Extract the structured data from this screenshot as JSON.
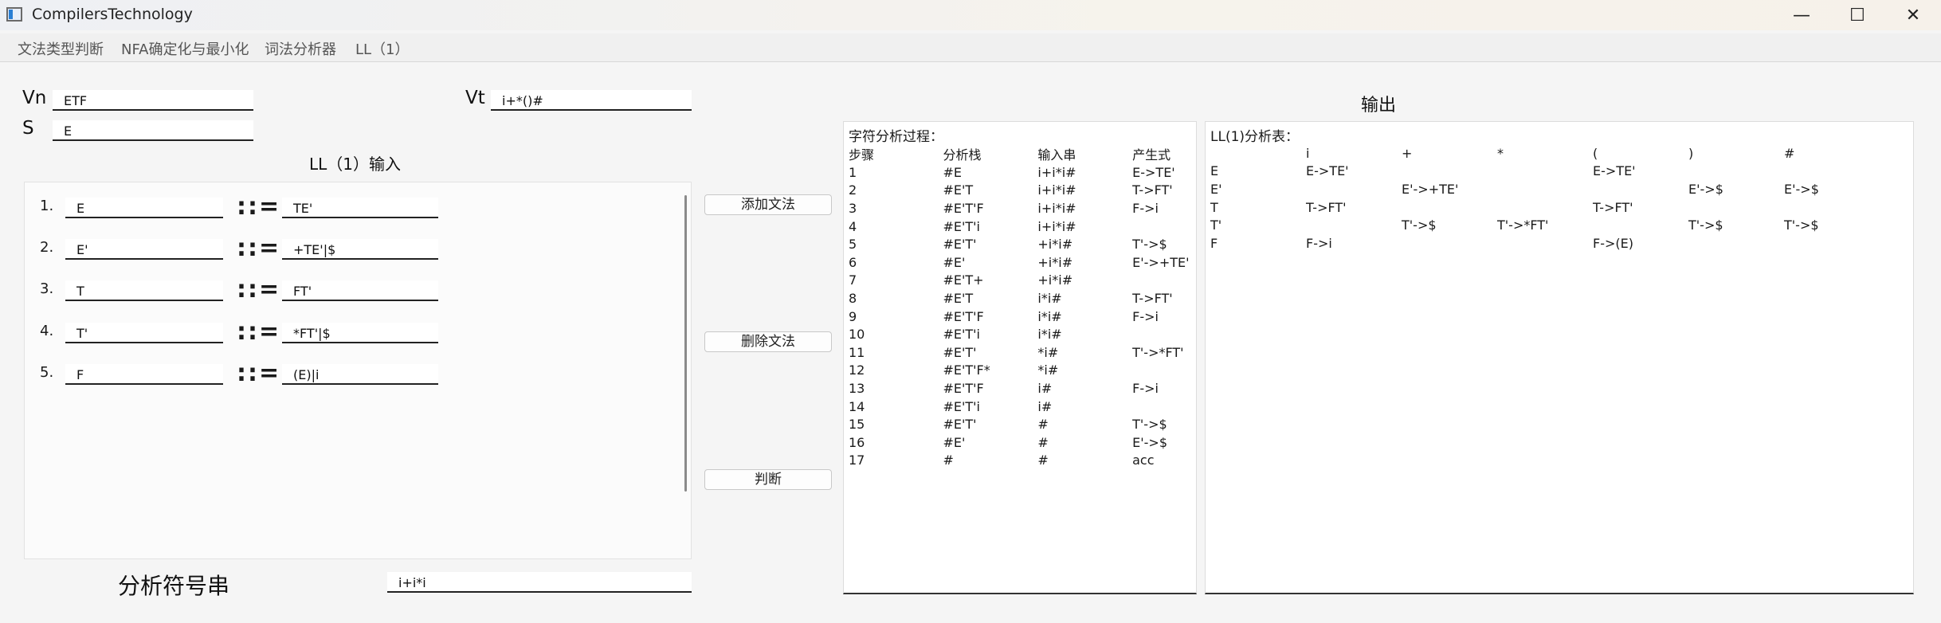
{
  "window": {
    "title": "CompilersTechnology",
    "minimize_glyph": "—",
    "maximize_glyph": "☐",
    "close_glyph": "✕"
  },
  "menu": [
    "文法类型判断",
    "NFA确定化与最小化",
    "词法分析器",
    "LL（1）"
  ],
  "inputs": {
    "vn_label": "Vn",
    "vn_value": "ETF",
    "vt_label": "Vt",
    "vt_value": "i+*()#",
    "s_label": "S",
    "s_value": "E"
  },
  "grammar": {
    "heading": "LL（1）输入",
    "separator": "::=",
    "rules": [
      {
        "num": "1.",
        "left": "E",
        "right": "TE'"
      },
      {
        "num": "2.",
        "left": "E'",
        "right": "+TE'|$"
      },
      {
        "num": "3.",
        "left": "T",
        "right": "FT'"
      },
      {
        "num": "4.",
        "left": "T'",
        "right": "*FT'|$"
      },
      {
        "num": "5.",
        "left": "F",
        "right": "(E)|i"
      }
    ]
  },
  "buttons": {
    "add": "添加文法",
    "delete": "删除文法",
    "judge": "判断"
  },
  "analysis": {
    "label": "分析符号串",
    "value": "i+i*i"
  },
  "output": {
    "heading": "输出",
    "process": {
      "title": "字符分析过程：",
      "headers": [
        "步骤",
        "分析栈",
        "输入串",
        "产生式"
      ],
      "rows": [
        [
          "1",
          "#E",
          "i+i*i#",
          "E->TE'"
        ],
        [
          "2",
          "#E'T",
          "i+i*i#",
          "T->FT'"
        ],
        [
          "3",
          "#E'T'F",
          "i+i*i#",
          "F->i"
        ],
        [
          "4",
          "#E'T'i",
          "i+i*i#",
          ""
        ],
        [
          "5",
          "#E'T'",
          "+i*i#",
          "T'->$"
        ],
        [
          "6",
          "#E'",
          "+i*i#",
          "E'->+TE'"
        ],
        [
          "7",
          "#E'T+",
          "+i*i#",
          ""
        ],
        [
          "8",
          "#E'T",
          "i*i#",
          "T->FT'"
        ],
        [
          "9",
          "#E'T'F",
          "i*i#",
          "F->i"
        ],
        [
          "10",
          "#E'T'i",
          "i*i#",
          ""
        ],
        [
          "11",
          "#E'T'",
          "*i#",
          "T'->*FT'"
        ],
        [
          "12",
          "#E'T'F*",
          "*i#",
          ""
        ],
        [
          "13",
          "#E'T'F",
          "i#",
          "F->i"
        ],
        [
          "14",
          "#E'T'i",
          "i#",
          ""
        ],
        [
          "15",
          "#E'T'",
          "#",
          "T'->$"
        ],
        [
          "16",
          "#E'",
          "#",
          "E'->$"
        ],
        [
          "17",
          "#",
          "#",
          "acc"
        ]
      ]
    },
    "table": {
      "title": "LL(1)分析表：",
      "headers": [
        "",
        "i",
        "+",
        "*",
        "(",
        ")",
        "#"
      ],
      "rows": [
        [
          "E",
          "E->TE'",
          "",
          "",
          "E->TE'",
          "",
          ""
        ],
        [
          "E'",
          "",
          "E'->+TE'",
          "",
          "",
          "E'->$",
          "E'->$"
        ],
        [
          "T",
          "T->FT'",
          "",
          "",
          "T->FT'",
          "",
          ""
        ],
        [
          "T'",
          "",
          "T'->$",
          "T'->*FT'",
          "",
          "T'->$",
          "T'->$"
        ],
        [
          "F",
          "F->i",
          "",
          "",
          "F->(E)",
          "",
          ""
        ]
      ]
    }
  }
}
